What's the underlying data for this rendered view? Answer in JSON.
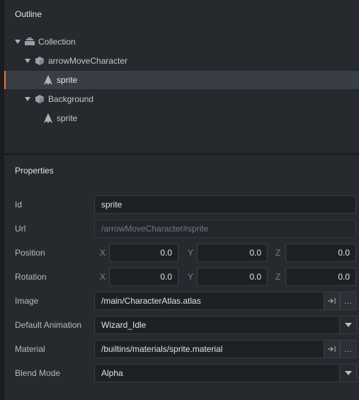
{
  "outline": {
    "title": "Outline",
    "items": [
      {
        "label": "Collection",
        "icon": "collection-icon",
        "expanded": true,
        "selected": false
      },
      {
        "label": "arrowMoveCharacter",
        "icon": "gameobject-icon",
        "expanded": true,
        "selected": false
      },
      {
        "label": "sprite",
        "icon": "sprite-icon",
        "selected": true
      },
      {
        "label": "Background",
        "icon": "gameobject-icon",
        "expanded": true,
        "selected": false
      },
      {
        "label": "sprite",
        "icon": "sprite-icon",
        "selected": false
      }
    ]
  },
  "properties": {
    "title": "Properties",
    "id": {
      "label": "Id",
      "value": "sprite"
    },
    "url": {
      "label": "Url",
      "value": "/arrowMoveCharacter#sprite"
    },
    "position": {
      "label": "Position",
      "x_label": "X",
      "y_label": "Y",
      "z_label": "Z",
      "x": "0.0",
      "y": "0.0",
      "z": "0.0"
    },
    "rotation": {
      "label": "Rotation",
      "x_label": "X",
      "y_label": "Y",
      "z_label": "Z",
      "x": "0.0",
      "y": "0.0",
      "z": "0.0"
    },
    "image": {
      "label": "Image",
      "value": "/main/CharacterAtlas.atlas",
      "goto_icon": "goto-icon",
      "browse_label": "…"
    },
    "default_animation": {
      "label": "Default Animation",
      "value": "Wizard_Idle"
    },
    "material": {
      "label": "Material",
      "value": "/builtins/materials/sprite.material",
      "goto_icon": "goto-icon",
      "browse_label": "…"
    },
    "blend_mode": {
      "label": "Blend Mode",
      "value": "Alpha"
    }
  },
  "colors": {
    "accent": "#e8743b",
    "selected_row": "#393d44",
    "panel": "#26292e"
  }
}
